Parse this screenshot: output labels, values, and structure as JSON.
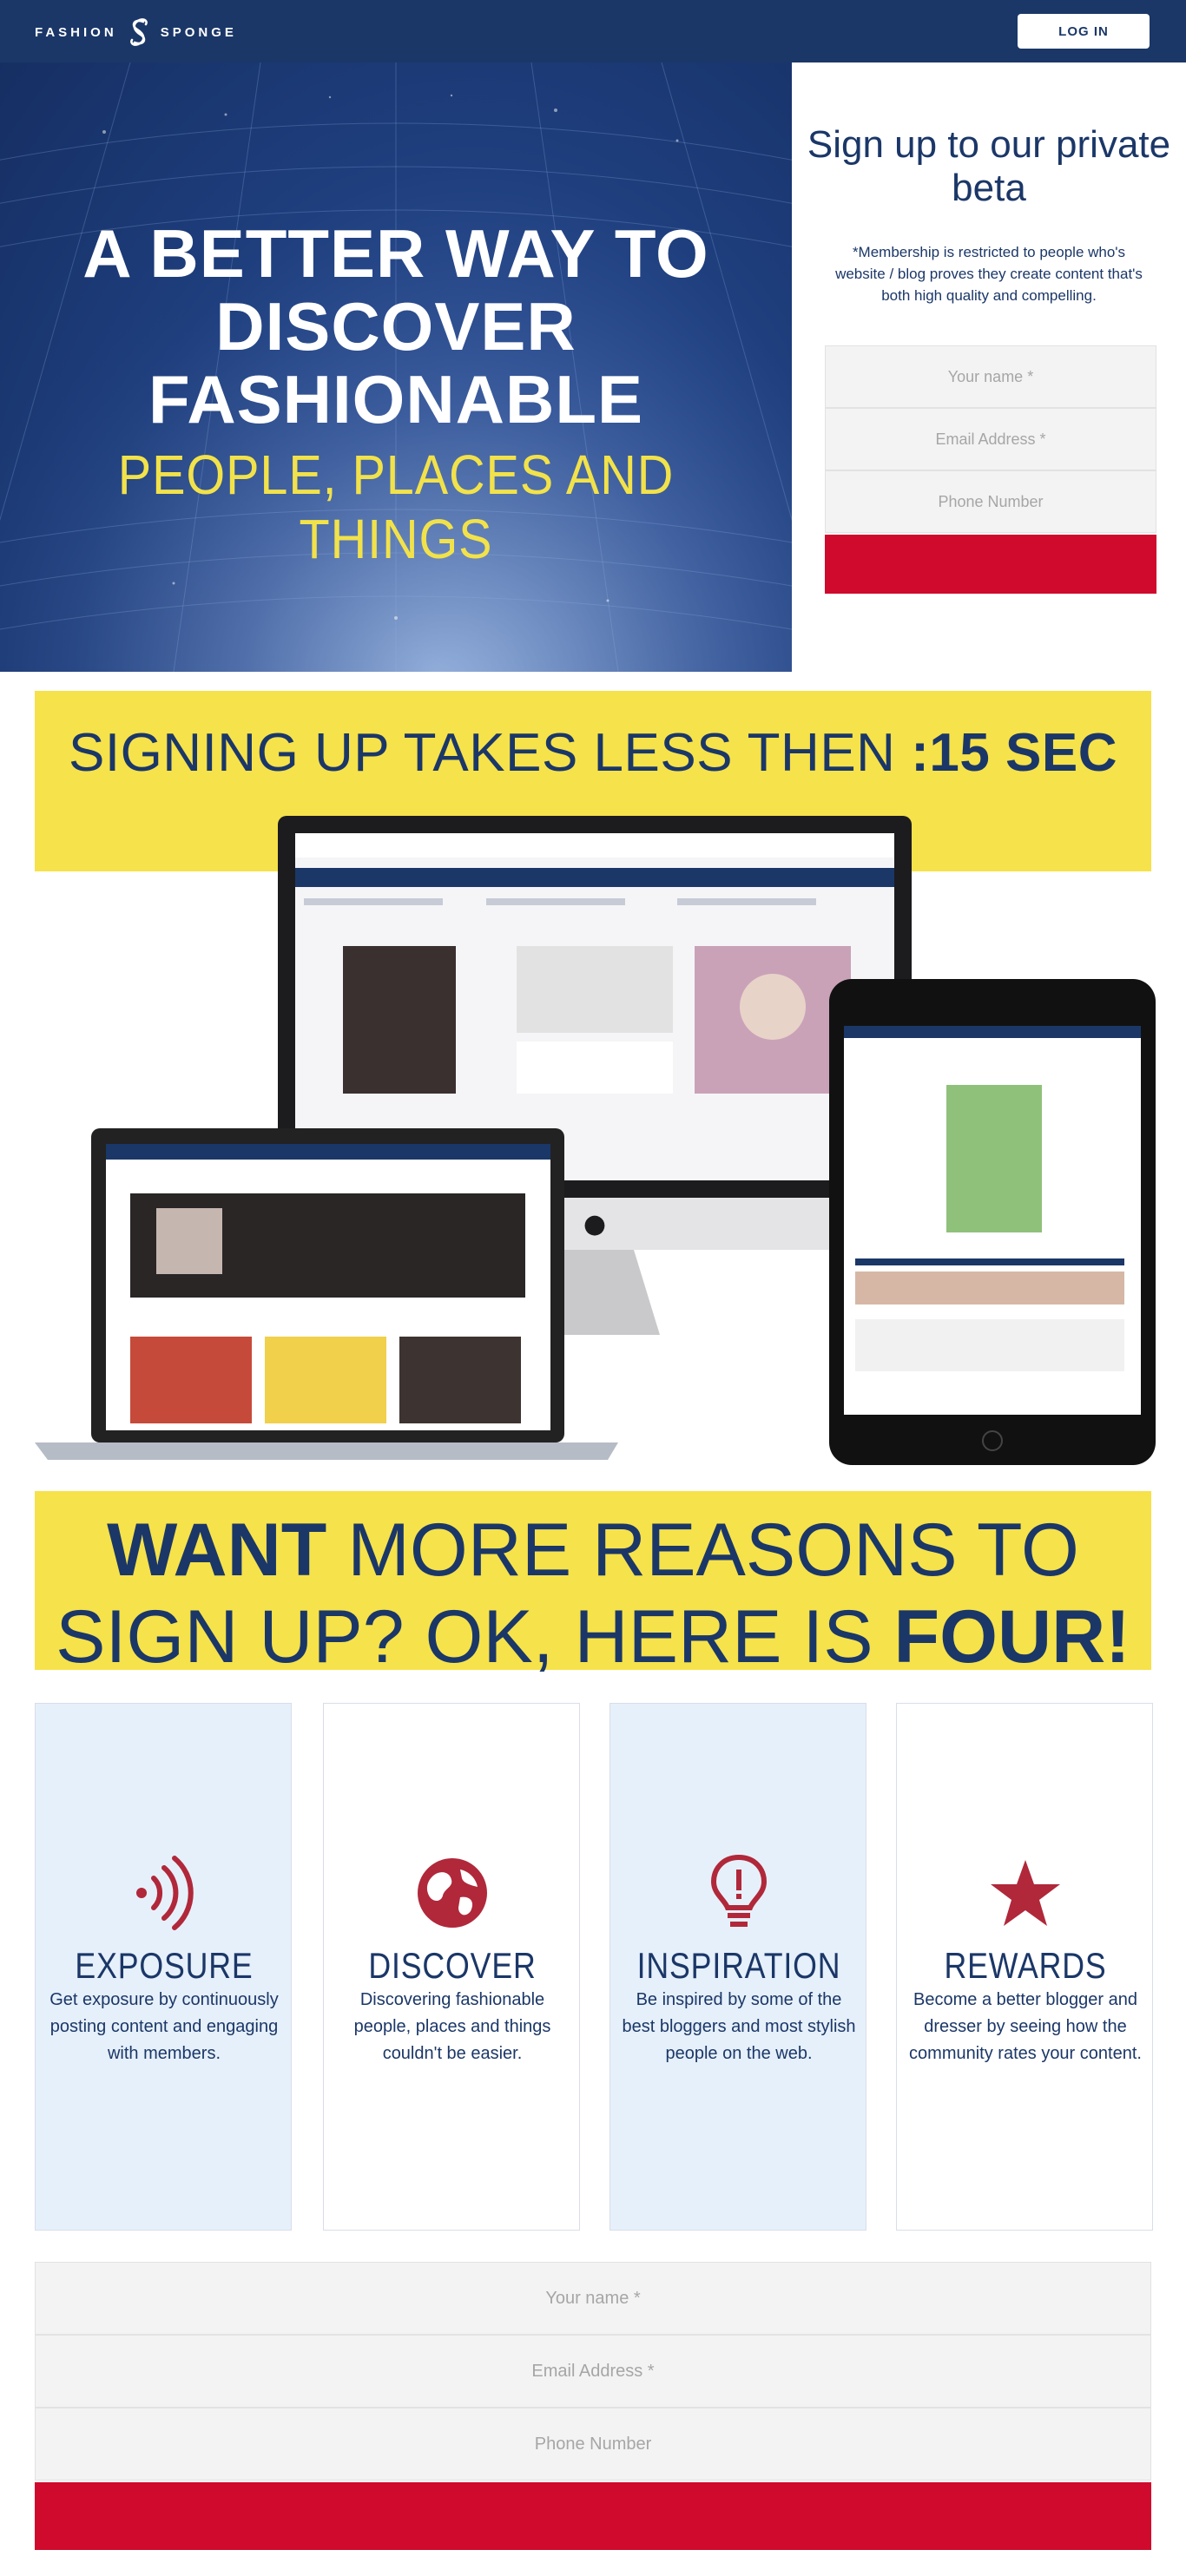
{
  "header": {
    "logo_left": "FASHION",
    "logo_right": "SPONGE",
    "login_label": "LOG IN"
  },
  "hero": {
    "headline": "A BETTER WAY TO DISCOVER FASHIONABLE",
    "subhead": "PEOPLE, PLACES AND THINGS"
  },
  "signup": {
    "title": "Sign up to our private beta",
    "note": "*Membership is restricted to people who's website / blog proves they create content that's both high quality and compelling.",
    "name_placeholder": "Your name *",
    "email_placeholder": "Email Address *",
    "phone_placeholder": "Phone Number"
  },
  "banner1": {
    "text": "SIGNING UP TAKES LESS THEN ",
    "bold": ":15 SEC"
  },
  "banner2": {
    "bold1": "WANT",
    "text1": " MORE REASONS TO",
    "text2": "SIGN UP? OK, HERE IS ",
    "bold2": "FOUR!"
  },
  "features": [
    {
      "title": "EXPOSURE",
      "icon": "signal-icon",
      "desc": "Get exposure by continuously posting content and engaging with members."
    },
    {
      "title": "DISCOVER",
      "icon": "globe-icon",
      "desc": "Discovering fashionable people, places and things couldn't be easier."
    },
    {
      "title": "INSPIRATION",
      "icon": "lightbulb-icon",
      "desc": "Be inspired by some of the best bloggers and most stylish people on the web."
    },
    {
      "title": "REWARDS",
      "icon": "star-icon",
      "desc": "Become a better blogger and dresser by seeing how the community rates your content."
    }
  ],
  "bottom_form": {
    "name_placeholder": "Your name *",
    "email_placeholder": "Email Address *",
    "phone_placeholder": "Phone Number"
  },
  "colors": {
    "navy": "#1b3768",
    "yellow": "#f6e24a",
    "red": "#cf0a2c",
    "card_blue": "#e6f0fa"
  }
}
